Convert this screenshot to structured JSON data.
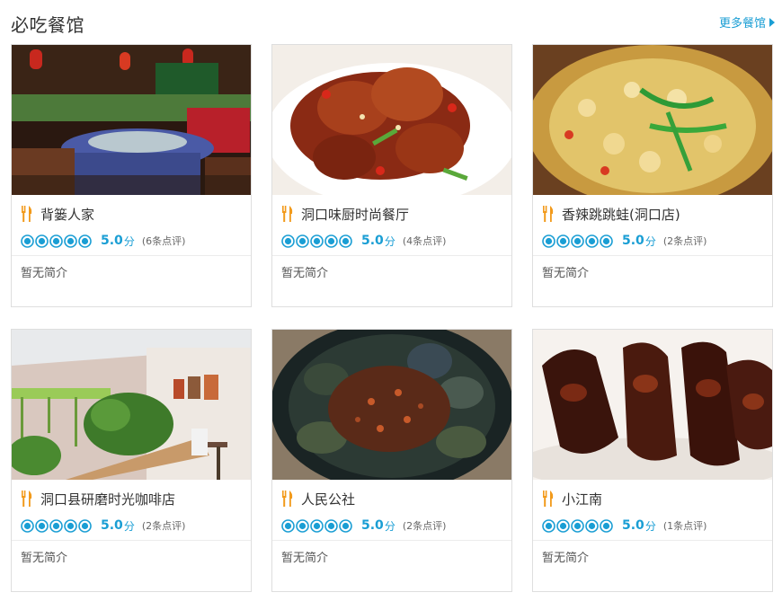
{
  "header": {
    "title": "必吃餐馆",
    "more_label": "更多餐馆"
  },
  "colors": {
    "accent": "#1a9ed4",
    "icon_orange": "#f29a1b",
    "border": "#dedede"
  },
  "restaurants": [
    {
      "name": "背篓人家",
      "score": "5.0",
      "score_unit": "分",
      "reviews": "(6条点评)",
      "intro": "暂无简介",
      "stars": 5,
      "photo": "restaurant-interior-photo"
    },
    {
      "name": "洞口味厨时尚餐厅",
      "score": "5.0",
      "score_unit": "分",
      "reviews": "(4条点评)",
      "intro": "暂无简介",
      "stars": 5,
      "photo": "braised-pork-dish-photo"
    },
    {
      "name": "香辣跳跳蛙(洞口店)",
      "score": "5.0",
      "score_unit": "分",
      "reviews": "(2条点评)",
      "intro": "暂无简介",
      "stars": 5,
      "photo": "spicy-frog-dish-photo"
    },
    {
      "name": "洞口县研磨时光咖啡店",
      "score": "5.0",
      "score_unit": "分",
      "reviews": "(2条点评)",
      "intro": "暂无简介",
      "stars": 5,
      "photo": "cafe-interior-photo"
    },
    {
      "name": "人民公社",
      "score": "5.0",
      "score_unit": "分",
      "reviews": "(2条点评)",
      "intro": "暂无简介",
      "stars": 5,
      "photo": "preserved-egg-dish-photo"
    },
    {
      "name": "小江南",
      "score": "5.0",
      "score_unit": "分",
      "reviews": "(1条点评)",
      "intro": "暂无简介",
      "stars": 5,
      "photo": "glazed-ribs-dish-photo"
    }
  ]
}
